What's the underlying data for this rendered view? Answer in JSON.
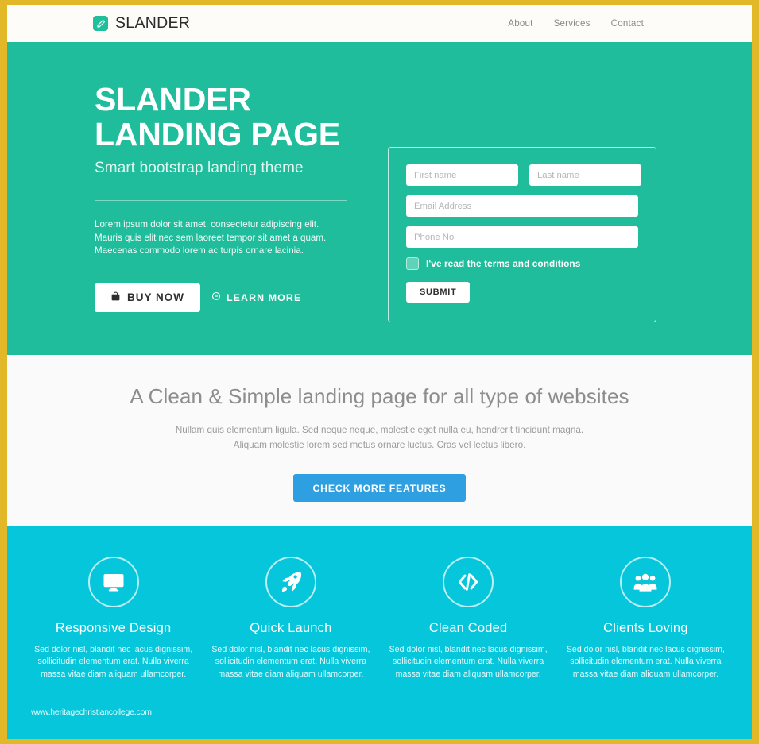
{
  "theme": {
    "frame_border": "#e2b828",
    "hero_bg": "#1fbd9b",
    "features_bg": "#06c6db",
    "clean_bg": "#fafafa",
    "accent_blue": "#2e9fe0",
    "brand_mark": "#1fbf9c"
  },
  "navbar": {
    "brand_name": "SLANDER",
    "brand_icon": "pencil-icon",
    "links": [
      {
        "label": "About"
      },
      {
        "label": "Services"
      },
      {
        "label": "Contact"
      }
    ]
  },
  "hero": {
    "title_line1": "SLANDER",
    "title_line2": "LANDING PAGE",
    "subtitle": "Smart bootstrap landing theme",
    "paragraph": "Lorem ipsum dolor sit amet, consectetur adipiscing elit. Mauris quis elit nec sem laoreet tempor sit amet a quam. Maecenas commodo lorem ac turpis ornare lacinia.",
    "buy_button": "BUY NOW",
    "buy_icon": "shopping-bag-icon",
    "learn_button": "LEARN MORE",
    "learn_icon": "circle-minus-icon"
  },
  "form": {
    "first_name_placeholder": "First name",
    "first_name_value": "",
    "last_name_placeholder": "Last name",
    "last_name_value": "",
    "email_placeholder": "Email Address",
    "email_value": "",
    "phone_placeholder": "Phone No",
    "phone_value": "",
    "terms_prefix": "I've read the",
    "terms_link": "terms",
    "terms_suffix": "and conditions",
    "checkbox_checked": false,
    "submit_label": "SUBMIT"
  },
  "clean": {
    "title": "A Clean & Simple landing page for all type of websites",
    "paragraph_line1": "Nullam quis elementum ligula. Sed neque neque, molestie eget nulla eu, hendrerit tincidunt magna.",
    "paragraph_line2": "Aliquam molestie lorem sed metus ornare luctus. Cras vel lectus libero.",
    "cta_label": "CHECK MORE FEATURES"
  },
  "features": {
    "items": [
      {
        "icon": "desktop-monitor-icon",
        "title": "Responsive Design",
        "desc": "Sed dolor nisl, blandit nec lacus dignissim, sollicitudin elementum erat. Nulla viverra massa vitae diam aliquam ullamcorper."
      },
      {
        "icon": "rocket-icon",
        "title": "Quick Launch",
        "desc": "Sed dolor nisl, blandit nec lacus dignissim, sollicitudin elementum erat. Nulla viverra massa vitae diam aliquam ullamcorper."
      },
      {
        "icon": "code-brackets-icon",
        "title": "Clean Coded",
        "desc": "Sed dolor nisl, blandit nec lacus dignissim, sollicitudin elementum erat. Nulla viverra massa vitae diam aliquam ullamcorper."
      },
      {
        "icon": "users-group-icon",
        "title": "Clients Loving",
        "desc": "Sed dolor nisl, blandit nec lacus dignissim, sollicitudin elementum erat. Nulla viverra massa vitae diam aliquam ullamcorper."
      }
    ]
  },
  "watermark": {
    "text": "www.heritagechristiancollege.com"
  }
}
